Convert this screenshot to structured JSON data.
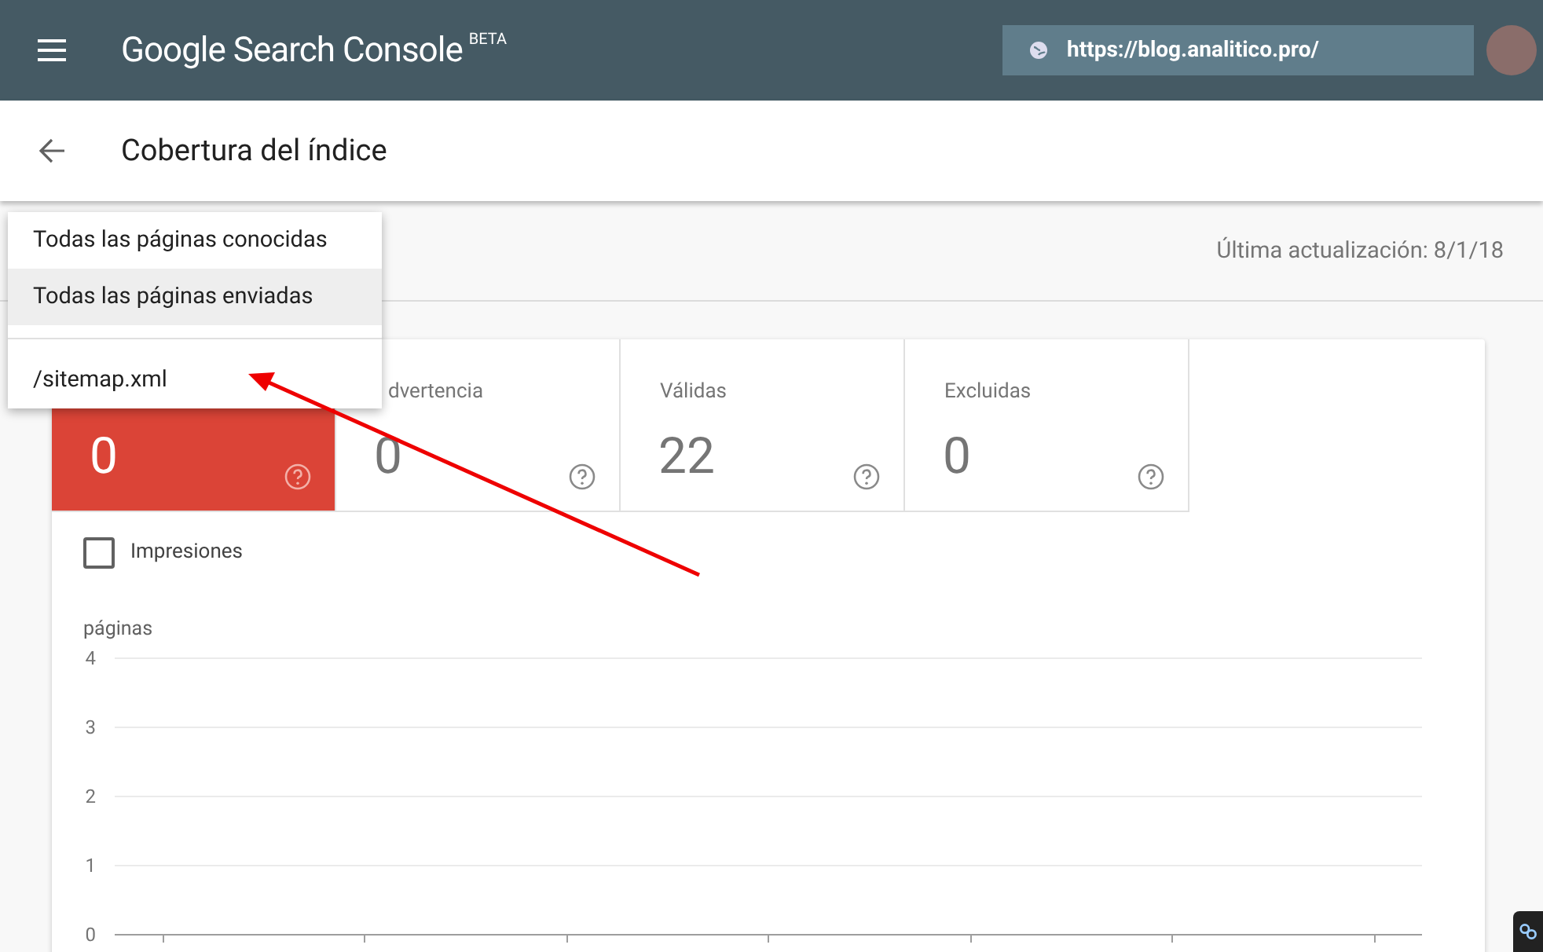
{
  "header": {
    "product": "Google Search Console",
    "badge": "BETA",
    "property": "https://blog.analitico.pro/"
  },
  "page": {
    "title": "Cobertura del índice"
  },
  "toolbar": {
    "last_update": "Última actualización: 8/1/18"
  },
  "menu": {
    "items": [
      {
        "label": "Todas las páginas conocidas",
        "selected": false
      },
      {
        "label": "Todas las páginas enviadas",
        "selected": true
      },
      {
        "label": "/sitemap.xml",
        "selected": false
      }
    ]
  },
  "tiles": [
    {
      "value": "0",
      "selected": true
    },
    {
      "label": "dvertencia",
      "value": "0",
      "selected": false
    },
    {
      "label": "Válidas",
      "value": "22",
      "selected": false
    },
    {
      "label": "Excluidas",
      "value": "0",
      "selected": false
    }
  ],
  "impressions": {
    "label": "Impresiones",
    "checked": false
  },
  "chart": {
    "axis_label": "páginas",
    "axis_ticks": [
      "4",
      "3",
      "2",
      "1",
      "0"
    ]
  }
}
